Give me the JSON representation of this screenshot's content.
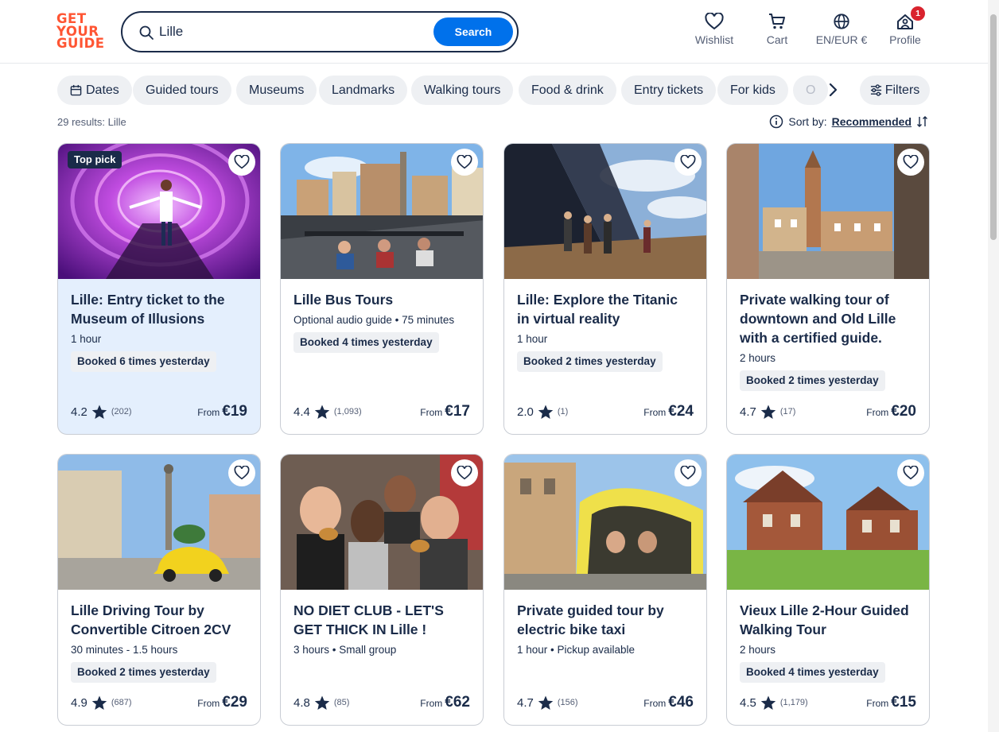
{
  "header": {
    "logo": [
      "GET",
      "YOUR",
      "GUIDE"
    ],
    "search_value": "Lille",
    "search_button": "Search",
    "nav": {
      "wishlist": "Wishlist",
      "cart": "Cart",
      "language": "EN/EUR €",
      "profile": "Profile",
      "profile_badge": "1"
    }
  },
  "chips": [
    "Dates",
    "Guided tours",
    "Museums",
    "Landmarks",
    "Walking tours",
    "Food & drink",
    "Entry tickets",
    "For kids",
    "O"
  ],
  "filters_label": "Filters",
  "results_text": "29 results: Lille",
  "sort": {
    "label": "Sort by:",
    "value": "Recommended"
  },
  "colors": {
    "accent": "#0071eb",
    "brand": "#ff5533",
    "text": "#1a2b49",
    "highlight": "#e4effd",
    "badge": "#d9232e"
  },
  "cards": [
    {
      "title": "Lille: Entry ticket to the Museum of Illusions",
      "meta": "1 hour",
      "booked": "Booked 6 times yesterday",
      "rating": "4.2",
      "reviews": "(202)",
      "from": "From",
      "price": "€19",
      "badge": "Top pick",
      "image": "illusion-tunnel"
    },
    {
      "title": "Lille Bus Tours",
      "meta": "Optional audio guide • 75 minutes",
      "booked": "Booked 4 times yesterday",
      "rating": "4.4",
      "reviews": "(1,093)",
      "from": "From",
      "price": "€17",
      "image": "open-top-bus"
    },
    {
      "title": "Lille: Explore the Titanic in virtual reality",
      "meta": "1 hour",
      "booked": "Booked 2 times yesterday",
      "rating": "2.0",
      "reviews": "(1)",
      "from": "From",
      "price": "€24",
      "image": "titanic-deck"
    },
    {
      "title": "Private walking tour of downtown and Old Lille with a certified guide.",
      "meta": "2 hours",
      "booked": "Booked 2 times yesterday",
      "rating": "4.7",
      "reviews": "(17)",
      "from": "From",
      "price": "€20",
      "image": "belfry-square"
    },
    {
      "title": "Lille Driving Tour by Convertible Citroen 2CV",
      "meta": "30 minutes - 1.5 hours",
      "booked": "Booked 2 times yesterday",
      "rating": "4.9",
      "reviews": "(687)",
      "from": "From",
      "price": "€29",
      "image": "yellow-2cv"
    },
    {
      "title": "NO DIET CLUB - LET'S GET THICK IN Lille !",
      "meta": "3 hours • Small group",
      "booked": "",
      "rating": "4.8",
      "reviews": "(85)",
      "from": "From",
      "price": "€62",
      "image": "food-friends"
    },
    {
      "title": "Private guided tour by electric bike taxi",
      "meta": "1 hour • Pickup available",
      "booked": "",
      "rating": "4.7",
      "reviews": "(156)",
      "from": "From",
      "price": "€46",
      "image": "bike-taxi"
    },
    {
      "title": "Vieux Lille 2-Hour Guided Walking Tour",
      "meta": "2 hours",
      "booked": "Booked 4 times yesterday",
      "rating": "4.5",
      "reviews": "(1,179)",
      "from": "From",
      "price": "€15",
      "image": "brick-house"
    }
  ]
}
